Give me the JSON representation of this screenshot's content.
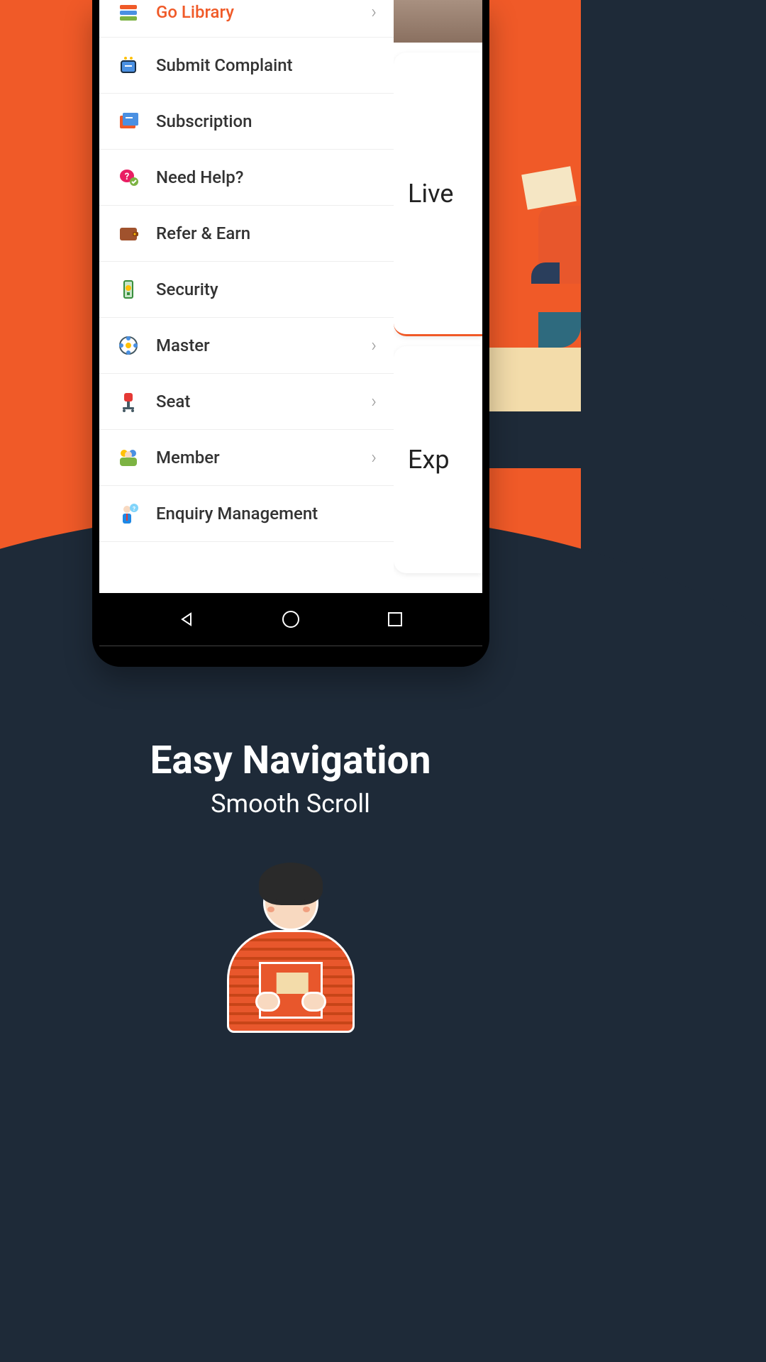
{
  "menu": {
    "items": [
      {
        "label": "Go Library",
        "active": true,
        "has_chevron": true,
        "icon": "books"
      },
      {
        "label": "Submit Complaint",
        "active": false,
        "has_chevron": false,
        "icon": "complaint"
      },
      {
        "label": "Subscription",
        "active": false,
        "has_chevron": false,
        "icon": "subscription"
      },
      {
        "label": "Need Help?",
        "active": false,
        "has_chevron": false,
        "icon": "help"
      },
      {
        "label": "Refer & Earn",
        "active": false,
        "has_chevron": false,
        "icon": "wallet"
      },
      {
        "label": "Security",
        "active": false,
        "has_chevron": false,
        "icon": "security"
      },
      {
        "label": "Master",
        "active": false,
        "has_chevron": true,
        "icon": "master"
      },
      {
        "label": "Seat",
        "active": false,
        "has_chevron": true,
        "icon": "seat"
      },
      {
        "label": "Member",
        "active": false,
        "has_chevron": true,
        "icon": "member"
      },
      {
        "label": "Enquiry Management",
        "active": false,
        "has_chevron": false,
        "icon": "enquiry"
      }
    ]
  },
  "peek": {
    "live": "Live",
    "exp": "Exp"
  },
  "promo": {
    "title": "Easy Navigation",
    "subtitle": "Smooth Scroll"
  },
  "colors": {
    "accent": "#f05a28",
    "dark": "#1e2a38"
  }
}
